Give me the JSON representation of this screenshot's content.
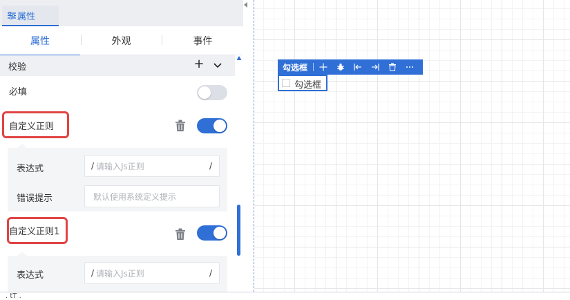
{
  "panel": {
    "title_tab": "属性",
    "subtabs": [
      "属性",
      "外观",
      "事件"
    ],
    "section_title": "校验",
    "required_label": "必填",
    "rules": [
      {
        "title": "自定义正则",
        "enabled": true,
        "expression_label": "表达式",
        "expression_placeholder": "请输入Js正则",
        "slash": "/",
        "error_label": "错误提示",
        "error_placeholder": "默认使用系统定义提示"
      },
      {
        "title": "自定义正则1",
        "enabled": true,
        "expression_label": "表达式",
        "expression_placeholder": "请输入Js正则",
        "slash": "/"
      }
    ]
  },
  "canvas": {
    "toolbar_title": "勾选框",
    "component_label": "勾选框"
  },
  "bottom": {
    "text": ".     tT  ."
  },
  "colors": {
    "accent": "#2f6fd6",
    "highlight": "#e04444"
  }
}
